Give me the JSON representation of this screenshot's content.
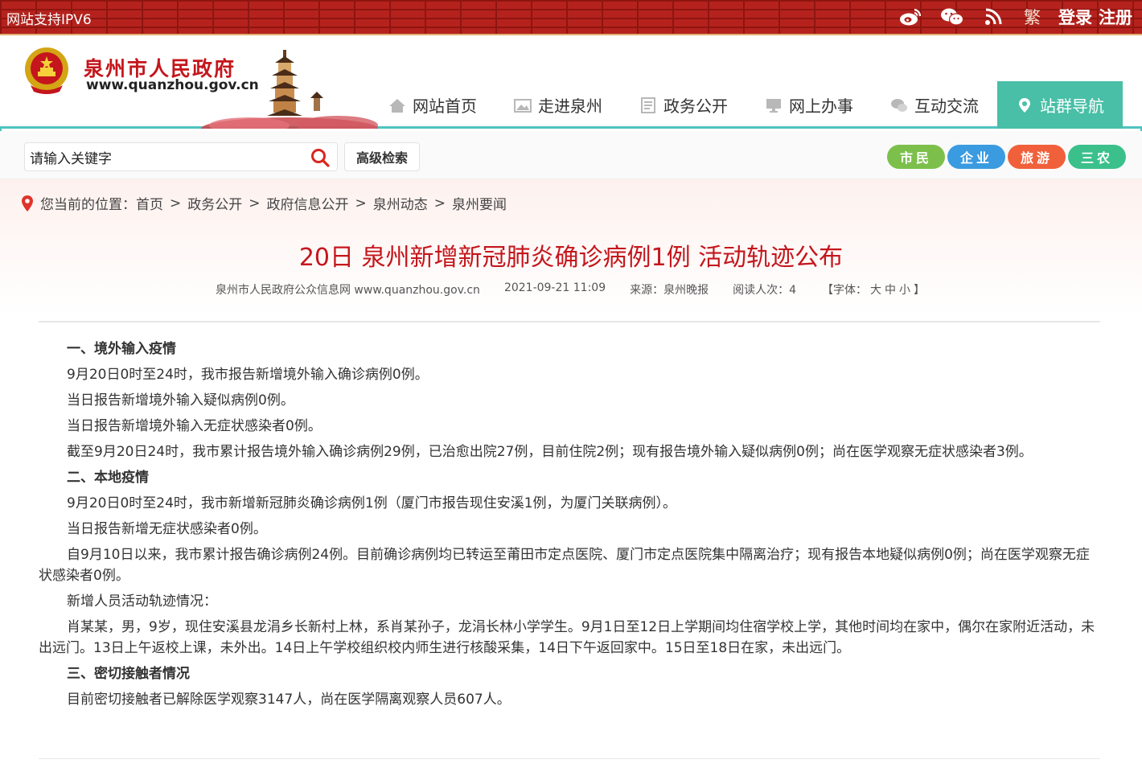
{
  "topbar": {
    "ipv6": "网站支持IPV6",
    "traditional": "繁",
    "login": "登录",
    "register": "注册"
  },
  "header": {
    "site_name": "泉州市人民政府",
    "site_url": "www.quanzhou.gov.cn",
    "nav": [
      {
        "label": "网站首页",
        "icon": "home-icon"
      },
      {
        "label": "走进泉州",
        "icon": "image-icon"
      },
      {
        "label": "政务公开",
        "icon": "document-icon"
      },
      {
        "label": "网上办事",
        "icon": "monitor-icon"
      },
      {
        "label": "互动交流",
        "icon": "chat-icon"
      },
      {
        "label": "站群导航",
        "icon": "location-icon"
      }
    ],
    "active_color": "#48bfa6"
  },
  "search": {
    "value": "请输入关键字",
    "advanced_label": "高级检索",
    "pills": [
      {
        "label": "市民",
        "color": "#7cc04b"
      },
      {
        "label": "企业",
        "color": "#3a9be0"
      },
      {
        "label": "旅游",
        "color": "#f0603a"
      },
      {
        "label": "三农",
        "color": "#3bc08c"
      }
    ]
  },
  "breadcrumb": {
    "prefix": "您当前的位置：",
    "items": [
      "首页",
      "政务公开",
      "政府信息公开",
      "泉州动态",
      "泉州要闻"
    ]
  },
  "article": {
    "title": "20日 泉州新增新冠肺炎确诊病例1例 活动轨迹公布",
    "meta": {
      "source_site": "泉州市人民政府公众信息网 www.quanzhou.gov.cn",
      "datetime": "2021-09-21 11:09",
      "source": "来源：泉州晚报",
      "reads": "阅读人次：4",
      "font_prefix": "【字体：",
      "font_large": "大",
      "font_medium": "中",
      "font_small": "小",
      "font_suffix": "】"
    },
    "paragraphs": [
      {
        "text": "一、境外输入疫情",
        "heading": true
      },
      {
        "text": "9月20日0时至24时，我市报告新增境外输入确诊病例0例。",
        "heading": false
      },
      {
        "text": "当日报告新增境外输入疑似病例0例。",
        "heading": false
      },
      {
        "text": "当日报告新增境外输入无症状感染者0例。",
        "heading": false
      },
      {
        "text": "截至9月20日24时，我市累计报告境外输入确诊病例29例，已治愈出院27例，目前住院2例；现有报告境外输入疑似病例0例；尚在医学观察无症状感染者3例。",
        "heading": false
      },
      {
        "text": "二、本地疫情",
        "heading": true
      },
      {
        "text": "9月20日0时至24时，我市新增新冠肺炎确诊病例1例（厦门市报告现住安溪1例，为厦门关联病例）。",
        "heading": false
      },
      {
        "text": "当日报告新增无症状感染者0例。",
        "heading": false
      },
      {
        "text": "自9月10日以来，我市累计报告确诊病例24例。目前确诊病例均已转运至莆田市定点医院、厦门市定点医院集中隔离治疗；现有报告本地疑似病例0例；尚在医学观察无症状感染者0例。",
        "heading": false
      },
      {
        "text": "新增人员活动轨迹情况：",
        "heading": false
      },
      {
        "text": "肖某某，男，9岁，现住安溪县龙涓乡长新村上林，系肖某孙子，龙涓长林小学学生。9月1日至12日上学期间均住宿学校上学，其他时间均在家中，偶尔在家附近活动，未出远门。13日上午返校上课，未外出。14日上午学校组织校内师生进行核酸采集，14日下午返回家中。15日至18日在家，未出远门。",
        "heading": false
      },
      {
        "text": "三、密切接触者情况",
        "heading": true
      },
      {
        "text": "目前密切接触者已解除医学观察3147人，尚在医学隔离观察人员607人。",
        "heading": false
      }
    ]
  }
}
